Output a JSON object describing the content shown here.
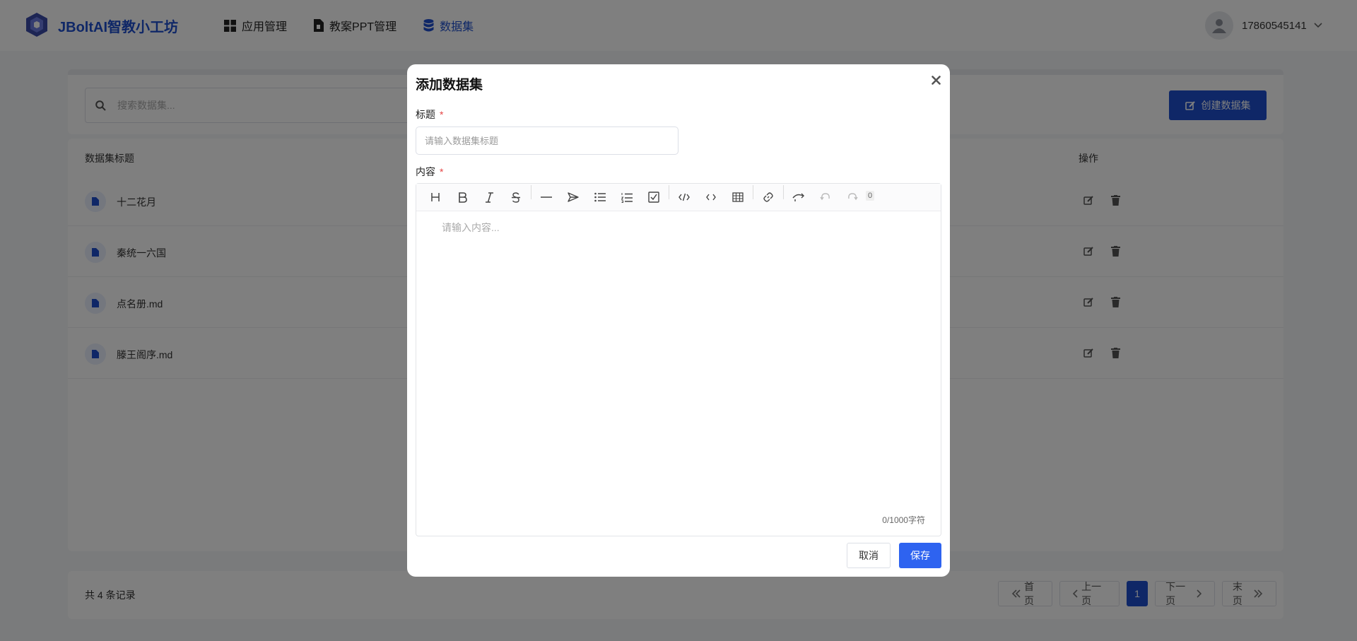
{
  "header": {
    "brand": "JBoltAI智教小工坊",
    "nav": [
      {
        "label": "应用管理",
        "icon": "grid-icon"
      },
      {
        "label": "教案PPT管理",
        "icon": "file-icon"
      },
      {
        "label": "数据集",
        "icon": "database-icon"
      }
    ],
    "active_nav": "数据集",
    "username": "17860545141"
  },
  "toolbar": {
    "search_placeholder": "搜索数据集...",
    "create_label": "创建数据集"
  },
  "table": {
    "col_title": "数据集标题",
    "col_actions": "操作",
    "rows": [
      "十二花月",
      "秦统一六国",
      "点名册.md",
      "滕王阁序.md"
    ]
  },
  "pagination": {
    "record_count": "共 4 条记录",
    "first": "首页",
    "prev": "上一页",
    "current": "1",
    "next": "下一页",
    "last": "末页"
  },
  "modal": {
    "title": "添加数据集",
    "title_label": "标题",
    "title_placeholder": "请输入数据集标题",
    "content_label": "内容",
    "required_mark": "*",
    "content_placeholder": "请输入内容...",
    "word_badge": "0",
    "char_count": "0/1000字符",
    "cancel": "取消",
    "save": "保存"
  },
  "colors": {
    "brand": "#1e4fcf",
    "primary_button": "#2e63f0",
    "required": "#e54545"
  }
}
